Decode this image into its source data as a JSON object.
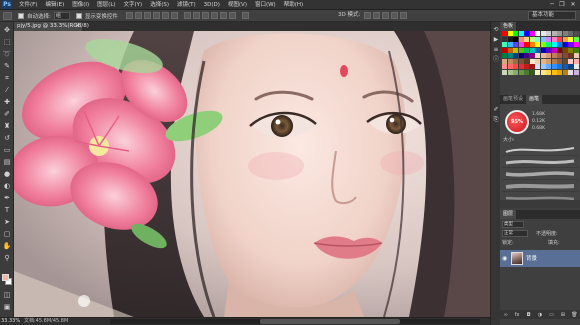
{
  "app": {
    "logo": "Ps"
  },
  "menu": {
    "items": [
      "文件(F)",
      "编辑(E)",
      "图像(I)",
      "图层(L)",
      "文字(Y)",
      "选择(S)",
      "滤镜(T)",
      "3D(D)",
      "视图(V)",
      "窗口(W)",
      "帮助(H)"
    ]
  },
  "window": {
    "minimize": "─",
    "restore": "❐",
    "close": "✕"
  },
  "options": {
    "auto_select_label": "自动选择:",
    "auto_select_value": "组",
    "show_transform_label": "显示变换控件",
    "mode_3d_label": "3D 模式:",
    "workspace": "基本功能"
  },
  "document": {
    "tab_title": "pjy/5.jpg @ 33.3%(RGB/8)",
    "close": "×"
  },
  "status": {
    "zoom": "33.33%",
    "doc_size": "文档:45.8M/45.8M"
  },
  "colors": {
    "foreground": "#f2b7a0",
    "background": "#ffffff",
    "accent_selected_layer": "#5a6f96",
    "brush_preview": "#d6262c"
  },
  "swatches": {
    "colors": [
      "#ff0000",
      "#ffff00",
      "#00ff00",
      "#00ffff",
      "#0000ff",
      "#ff00ff",
      "#ffffff",
      "#e6e6e6",
      "#cccccc",
      "#b3b3b3",
      "#999999",
      "#808080",
      "#666666",
      "#4d4d4d",
      "#333333",
      "#1a1a1a",
      "#000000",
      "#ff8080",
      "#ffd480",
      "#c0ff80",
      "#80ffd4",
      "#80c0ff",
      "#d480ff",
      "#ff80c0",
      "#ff4040",
      "#ff9f40",
      "#f6ff40",
      "#60ff40",
      "#40ffb5",
      "#40b5ff",
      "#6040ff",
      "#f640ff",
      "#ff0000",
      "#ff7f00",
      "#ffff00",
      "#7fff00",
      "#00ff7f",
      "#00ffff",
      "#007fff",
      "#0000ff",
      "#7f00ff",
      "#ff00ff",
      "#c00000",
      "#c06000",
      "#c0c000",
      "#60c000",
      "#00c060",
      "#00c0c0",
      "#0060c0",
      "#0000c0",
      "#6000c0",
      "#c000c0",
      "#800000",
      "#804000",
      "#808000",
      "#408000",
      "#008040",
      "#008080",
      "#004080",
      "#000080",
      "#400080",
      "#800080",
      "#f2d6c8",
      "#e8b9a0",
      "#d99a7c",
      "#c47a5c",
      "#a85c40",
      "#8a4630",
      "#6c3422",
      "#e9cbb1",
      "#d7a981",
      "#bf8a5e",
      "#9d6c44",
      "#7b5331",
      "#5a3c23",
      "#f9e5d2",
      "#f0cfae",
      "#e4b58a",
      "#d49b6b",
      "#b47d50",
      "#8f623d",
      "#6a4a2f",
      "#ffc7c7",
      "#ffadad",
      "#ff8f8f",
      "#ff6b6b",
      "#ff4747",
      "#e23030",
      "#c01f1f",
      "#9e1515",
      "#cce5ff",
      "#99c9ff",
      "#66adff",
      "#3391ff",
      "#1a75e0",
      "#145bb0",
      "#0f4280",
      "#eaeaea",
      "#c9d6b8",
      "#a8c290",
      "#87ad68",
      "#669940",
      "#4d7a2e",
      "#385a22",
      "#fff3c4",
      "#ffe48a",
      "#ffd54f",
      "#ffc107",
      "#e0a800",
      "#b38600",
      "#e8d7f2",
      "#cfb0e3"
    ]
  },
  "panels": {
    "top_tabs": [
      "色板"
    ],
    "brush_tabs": [
      "画笔预设",
      "画笔"
    ],
    "brush_preview_label": "95%",
    "brush_sizes": [
      "1.68K",
      "0.12K",
      "0.68K"
    ],
    "brush_size_label": "大小:",
    "layers_tab": "图层",
    "kind_label": "类型",
    "blend_mode": "正常",
    "opacity_label": "不透明度:",
    "lock_label": "锁定:",
    "fill_label": "填充:",
    "layer_name": "背景"
  },
  "icons": {
    "tools": [
      "move-icon",
      "marquee-icon",
      "lasso-icon",
      "quick-select-icon",
      "crop-icon",
      "eyedropper-icon",
      "healing-icon",
      "brush-icon",
      "stamp-icon",
      "history-brush-icon",
      "eraser-icon",
      "gradient-icon",
      "blur-icon",
      "dodge-icon",
      "pen-icon",
      "type-icon",
      "path-select-icon",
      "shape-icon",
      "hand-icon",
      "zoom-icon"
    ]
  }
}
